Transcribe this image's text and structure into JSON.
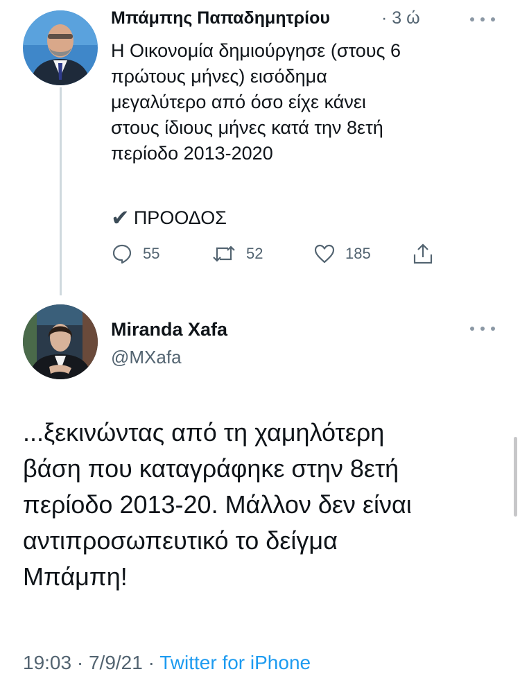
{
  "tweet1": {
    "author": "Μπάμπης Παπαδημητρίου",
    "separator": "·",
    "time": "3 ώ",
    "text": "Η Οικονομία δημιούργησε (στους 6\nπρώτους μήνες) εισόδημα\nμεγαλύτερο από όσο είχε κάνει\nστους ίδιους μήνες κατά την 8ετή\nπερίοδο 2013-2020",
    "check_icon": "heavy-check-mark",
    "check_text": "ΠΡΟΟΔΟΣ",
    "actions": {
      "reply_count": "55",
      "retweet_count": "52",
      "like_count": "185"
    }
  },
  "tweet2": {
    "name": "Miranda Xafa",
    "handle": "@MXafa",
    "text": "...ξεκινώντας από τη χαμηλότερη\nβάση που καταγράφηκε στην 8ετή\nπερίοδο 2013-20. Μάλλον δεν είναι\nαντιπροσωπευτικό το δείγμα\nΜπάμπη!",
    "time": "19:03",
    "sep1": "·",
    "date": "7/9/21",
    "sep2": "·",
    "source": "Twitter for iPhone"
  },
  "colors": {
    "text": "#0f1419",
    "secondary": "#536471",
    "link": "#1d9bf0",
    "thread_line": "#cfd9de"
  }
}
